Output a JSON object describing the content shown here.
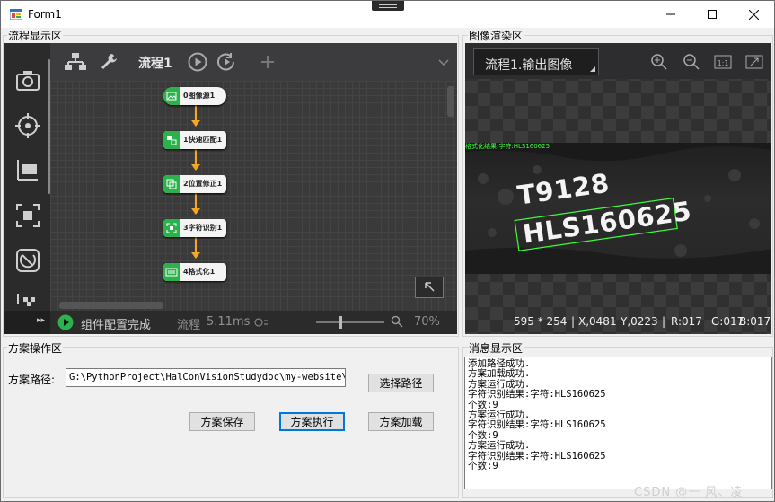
{
  "window": {
    "title": "Form1",
    "controls": {
      "minimize": "—",
      "maximize": "☐",
      "close": "✕"
    }
  },
  "flow_panel": {
    "group_label": "流程显示区",
    "tab_name": "流程1",
    "nodes": [
      {
        "label": "0图像源1"
      },
      {
        "label": "1快速匹配1"
      },
      {
        "label": "2位置修正1"
      },
      {
        "label": "3字符识别1"
      },
      {
        "label": "4格式化1"
      }
    ],
    "status": {
      "state": "组件配置完成",
      "flow_label": "流程",
      "time": "5.11ms",
      "zoom": "70%",
      "zoom_level": 0.7
    }
  },
  "image_panel": {
    "group_label": "图像渲染区",
    "dropdown_value": "流程1.输出图像",
    "overlay_text": "格式化结果:字符:HLS160625",
    "photo_text_line1": "T9128",
    "photo_text_line2": "HLS160625",
    "status": {
      "size": "595 * 254",
      "x": "X,0481",
      "y": "Y,0223",
      "r": "R:017",
      "g": "G:017",
      "b": "B:017"
    }
  },
  "scheme_panel": {
    "group_label": "方案操作区",
    "path_label": "方案路径:",
    "path_value": "G:\\PythonProject\\HalConVisionStudydoc\\my-website\\do",
    "select_path_button": "选择路径",
    "save_button": "方案保存",
    "execute_button": "方案执行",
    "load_button": "方案加载"
  },
  "message_panel": {
    "group_label": "消息显示区",
    "lines": [
      "添加路径成功.",
      "方案加载成功.",
      "方案运行成功.",
      "字符识别结果:字符:HLS160625",
      "个数:9",
      "方案运行成功.",
      "字符识别结果:字符:HLS160625",
      "个数:9",
      "方案运行成功.",
      "字符识别结果:字符:HLS160625",
      "个数:9"
    ]
  },
  "watermark": "CSDN @一 风、凌",
  "colors": {
    "node_green": "#2bb24c",
    "connector_orange": "#f5a623",
    "overlay_green": "#3cff3c",
    "primary_border": "#0078d7"
  }
}
